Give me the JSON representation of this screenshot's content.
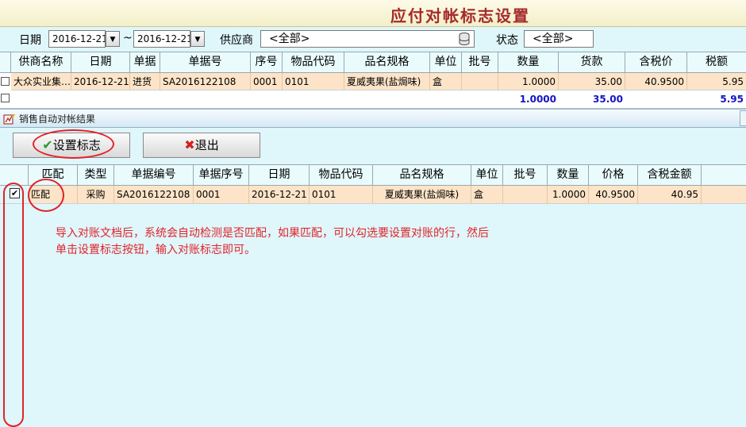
{
  "title": "应付对帐标志设置",
  "filter": {
    "date_label": "日期",
    "date_from": "2016-12-21",
    "tilde": "~",
    "date_to": "2016-12-21",
    "supplier_label": "供应商",
    "supplier_value": "<全部>",
    "status_label": "状态",
    "status_value": "<全部>"
  },
  "main_table": {
    "headers": [
      "供商名称",
      "日期",
      "单据",
      "单据号",
      "序号",
      "物品代码",
      "品名规格",
      "单位",
      "批号",
      "数量",
      "货款",
      "含税价",
      "税额"
    ],
    "row": [
      "大众实业集…",
      "2016-12-21",
      "进货",
      "SA2016122108",
      "0001",
      "0101",
      "夏威夷果(盐焗味)",
      "盒",
      "",
      "1.0000",
      "35.00",
      "40.9500",
      "5.95"
    ],
    "totals": {
      "qty": "1.0000",
      "amount": "35.00",
      "tax": "5.95"
    }
  },
  "dialog": {
    "title": "销售自动对帐结果",
    "set_flag_label": "设置标志",
    "exit_label": "退出",
    "headers": [
      "匹配",
      "类型",
      "单据编号",
      "单据序号",
      "日期",
      "物品代码",
      "品名规格",
      "单位",
      "批号",
      "数量",
      "价格",
      "含税金额"
    ],
    "row": [
      "匹配",
      "采购",
      "SA2016122108",
      "0001",
      "2016-12-21",
      "0101",
      "夏威夷果(盐焗味)",
      "盒",
      "",
      "1.0000",
      "40.9500",
      "40.95"
    ],
    "checked_mark": "✔",
    "note_line1": "导入对账文档后，系统会自动检测是否匹配，如果匹配，可以勾选要设置对账的行，然后",
    "note_line2": "单击设置标志按钮，输入对账标志即可。"
  }
}
